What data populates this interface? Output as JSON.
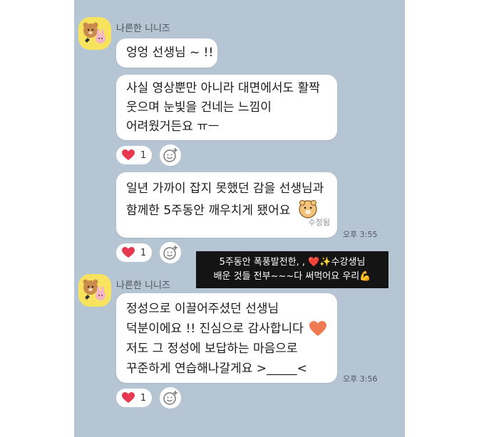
{
  "sender_name": "나른한 니니즈",
  "group1": {
    "messages": [
      {
        "lines": [
          "엉엉 선생님 ~ !!"
        ]
      },
      {
        "lines": [
          "사실 영상뿐만 아니라 대면에서도 활짝",
          "웃으며 눈빛을 건네는 느낌이",
          "어려웠거든요 ㅠㅡ"
        ]
      }
    ],
    "reaction_count": "1"
  },
  "group2": {
    "lines": [
      "일년 가까이 잡지 못했던 감을 선생님과",
      "함께한 5주동안 깨우치게 됐어요"
    ],
    "edited_label": "수정됨",
    "time": "오후 3:55",
    "reaction_count": "1"
  },
  "group3": {
    "lines": [
      "정성으로 이끌어주셨던 선생님",
      "덕분이에요 !! 진심으로 감사합니다",
      "저도 그 정성에 보답하는 마음으로",
      "꾸준하게 연습해나갈게요 >_____<"
    ],
    "time": "오후 3:56",
    "reaction_count": "1"
  },
  "caption": {
    "lines": [
      "5주동안  폭풍발전한, , ❤️✨수강생님",
      "배운  것들  전부~~~다  써먹어요  우리💪"
    ]
  },
  "colors": {
    "chat_bg": "#b6c5d4",
    "heart": "#e8384f",
    "avatar_bg": "#f7e35e"
  }
}
